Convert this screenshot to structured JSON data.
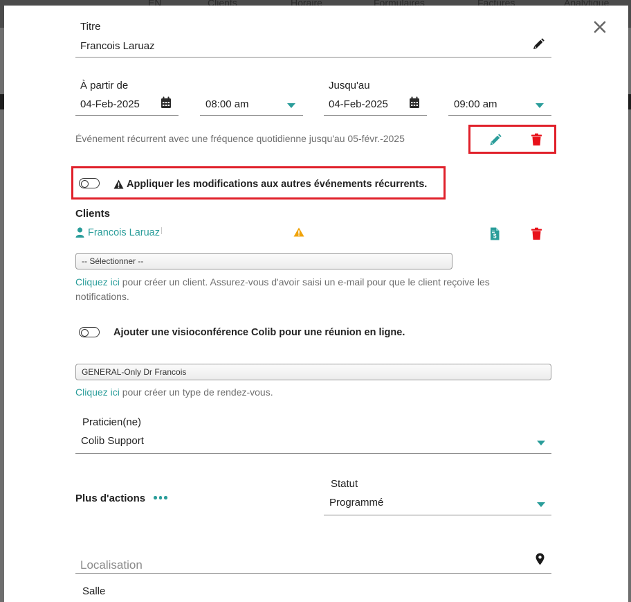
{
  "background": {
    "nav_items": [
      "EN",
      "Clients",
      "Horaire",
      "Formulaires",
      "Factures",
      "Analytique"
    ]
  },
  "colors": {
    "accent": "#2a9d9a",
    "danger": "#e8111a",
    "warning": "#f0a30a",
    "highlight_border": "#e0202a"
  },
  "form": {
    "title_label": "Titre",
    "title_value": "Francois Laruaz",
    "from_label": "À partir de",
    "from_date": "04-Feb-2025",
    "from_time": "08:00 am",
    "to_label": "Jusqu'au",
    "to_date": "04-Feb-2025",
    "to_time": "09:00 am",
    "recurrence_text": "Événement récurrent avec une fréquence quotidienne jusqu'au 05-févr.-2025",
    "apply_recurring_text": "Appliquer les modifications aux autres événements récurrents.",
    "clients_label": "Clients",
    "client_name": "Francois Laruaz",
    "client_select_placeholder": "-- Sélectionner --",
    "client_link": "Cliquez ici",
    "client_help": "pour créer un client. Assurez-vous d'avoir saisi un e-mail pour que le client reçoive les notifications.",
    "video_text": "Ajouter une visioconférence Colib pour une réunion en ligne.",
    "appointment_type_value": "GENERAL-Only Dr Francois",
    "appt_link": "Cliquez ici",
    "appt_help": "pour créer un type de rendez-vous.",
    "practitioner_label": "Praticien(ne)",
    "practitioner_value": "Colib Support",
    "more_actions_label": "Plus d'actions",
    "status_label": "Statut",
    "status_value": "Programmé",
    "location_placeholder": "Localisation",
    "room_label": "Salle"
  }
}
